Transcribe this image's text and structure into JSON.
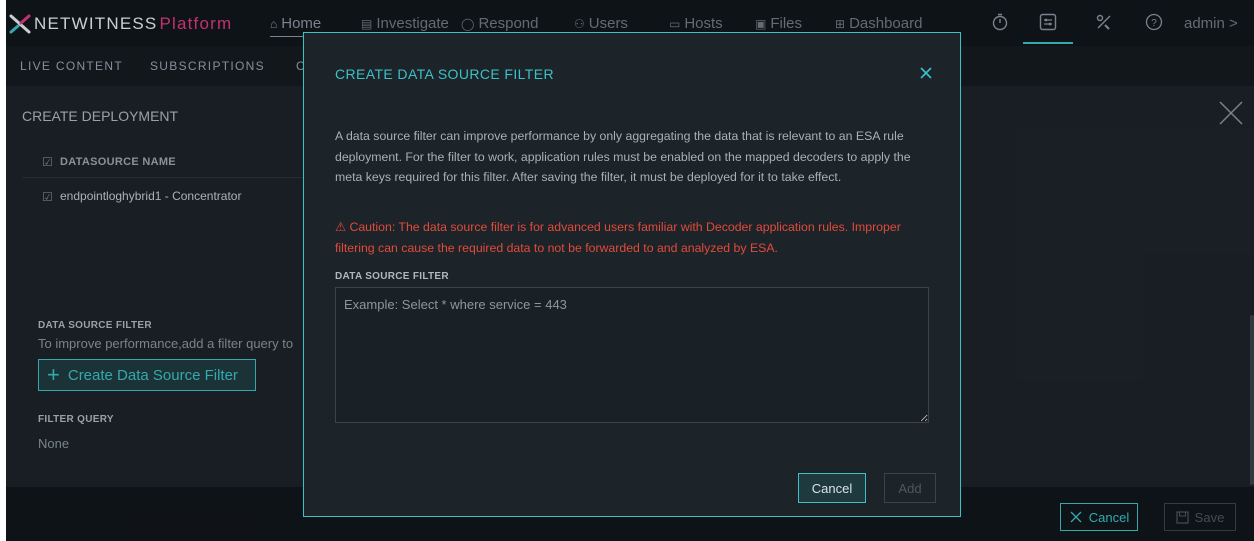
{
  "brand": {
    "name": "NETWITNESS",
    "suffix": "Platform",
    "logo_icon": "netwitness-x-logo"
  },
  "topnav": {
    "items": [
      {
        "label": "Home",
        "icon": "home-icon"
      },
      {
        "label": "Investigate",
        "icon": "investigate-icon"
      },
      {
        "label": "Respond",
        "icon": "respond-icon"
      },
      {
        "label": "Users",
        "icon": "users-icon"
      },
      {
        "label": "Hosts",
        "icon": "hosts-icon"
      },
      {
        "label": "Files",
        "icon": "files-icon"
      },
      {
        "label": "Dashboard",
        "icon": "dashboard-icon"
      }
    ],
    "icons": [
      "timer-icon",
      "admin-panel-icon",
      "tools-icon",
      "help-icon"
    ],
    "user": "admin >"
  },
  "subnav": {
    "items": [
      "LIVE CONTENT",
      "SUBSCRIPTIONS",
      "C"
    ]
  },
  "page": {
    "title": "CREATE DEPLOYMENT"
  },
  "table": {
    "header": "DATASOURCE NAME",
    "rows": [
      "endpointloghybrid1 - Concentrator"
    ]
  },
  "left": {
    "ds_filter_label": "DATA SOURCE FILTER",
    "ds_filter_hint": "To improve performance,add a filter query to",
    "create_button": "Create Data Source Filter",
    "filter_query_label": "FILTER QUERY",
    "filter_query_value": "None"
  },
  "footer": {
    "cancel": "Cancel",
    "save": "Save"
  },
  "modal": {
    "title": "CREATE DATA SOURCE FILTER",
    "description": "A data source filter can improve performance by only aggregating the data that is relevant to an ESA rule deployment. For the filter to work, application rules must be enabled on the mapped decoders to apply the meta keys required for this filter. After saving the filter, it must be deployed for it to take effect.",
    "caution": "⚠ Caution: The data source filter is for advanced users familiar with Decoder application rules. Improper filtering can cause the required data to not be forwarded to and analyzed by ESA.",
    "field_label": "DATA SOURCE FILTER",
    "field_value": "",
    "field_placeholder": "Example: Select * where service = 443",
    "cancel": "Cancel",
    "add": "Add"
  },
  "colors": {
    "accent": "#3bc1c7",
    "brand_pink": "#e0397a",
    "caution": "#e24b3a",
    "background": "#1c2329"
  }
}
